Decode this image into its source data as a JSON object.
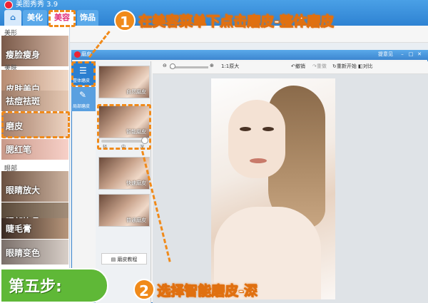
{
  "app": {
    "title": "美图秀秀 3.9"
  },
  "nav_tabs": [
    "美化",
    "美容",
    "饰品"
  ],
  "left_panel": {
    "sections": {
      "shape": "美形",
      "skin": "美肤",
      "eyes": "眼部"
    },
    "tools": [
      "瘦脸瘦身",
      "皮肤美白",
      "祛痘祛斑",
      "磨皮",
      "腮红笔",
      "眼睛放大",
      "眼部饰品",
      "睫毛膏",
      "眼睛变色"
    ]
  },
  "dialog": {
    "title": "磨皮",
    "feedback": "提意见",
    "side_tabs": [
      "整体磨皮",
      "局部磨皮"
    ],
    "effects": [
      "自然磨皮",
      "智能磨皮",
      "快速磨皮",
      "普通磨皮"
    ],
    "depth_levels": [
      "轻",
      "中",
      "深"
    ],
    "depth_value": "深",
    "tutorial_button": "磨皮教程",
    "toolbar": {
      "original_size": "1:1原大",
      "undo": "撤销",
      "redo": "重做",
      "reset": "重新开始",
      "compare": "对比"
    }
  },
  "annotations": {
    "step1": {
      "number": "1",
      "text": "在美容菜单下点击磨皮-整体磨皮"
    },
    "step2": {
      "number": "2",
      "text": "选择智能磨皮-深"
    },
    "banner": "第五步:"
  },
  "colors": {
    "accent": "#f08a1a",
    "banner": "#5fb837",
    "title_bar": "#2b7fd0"
  }
}
